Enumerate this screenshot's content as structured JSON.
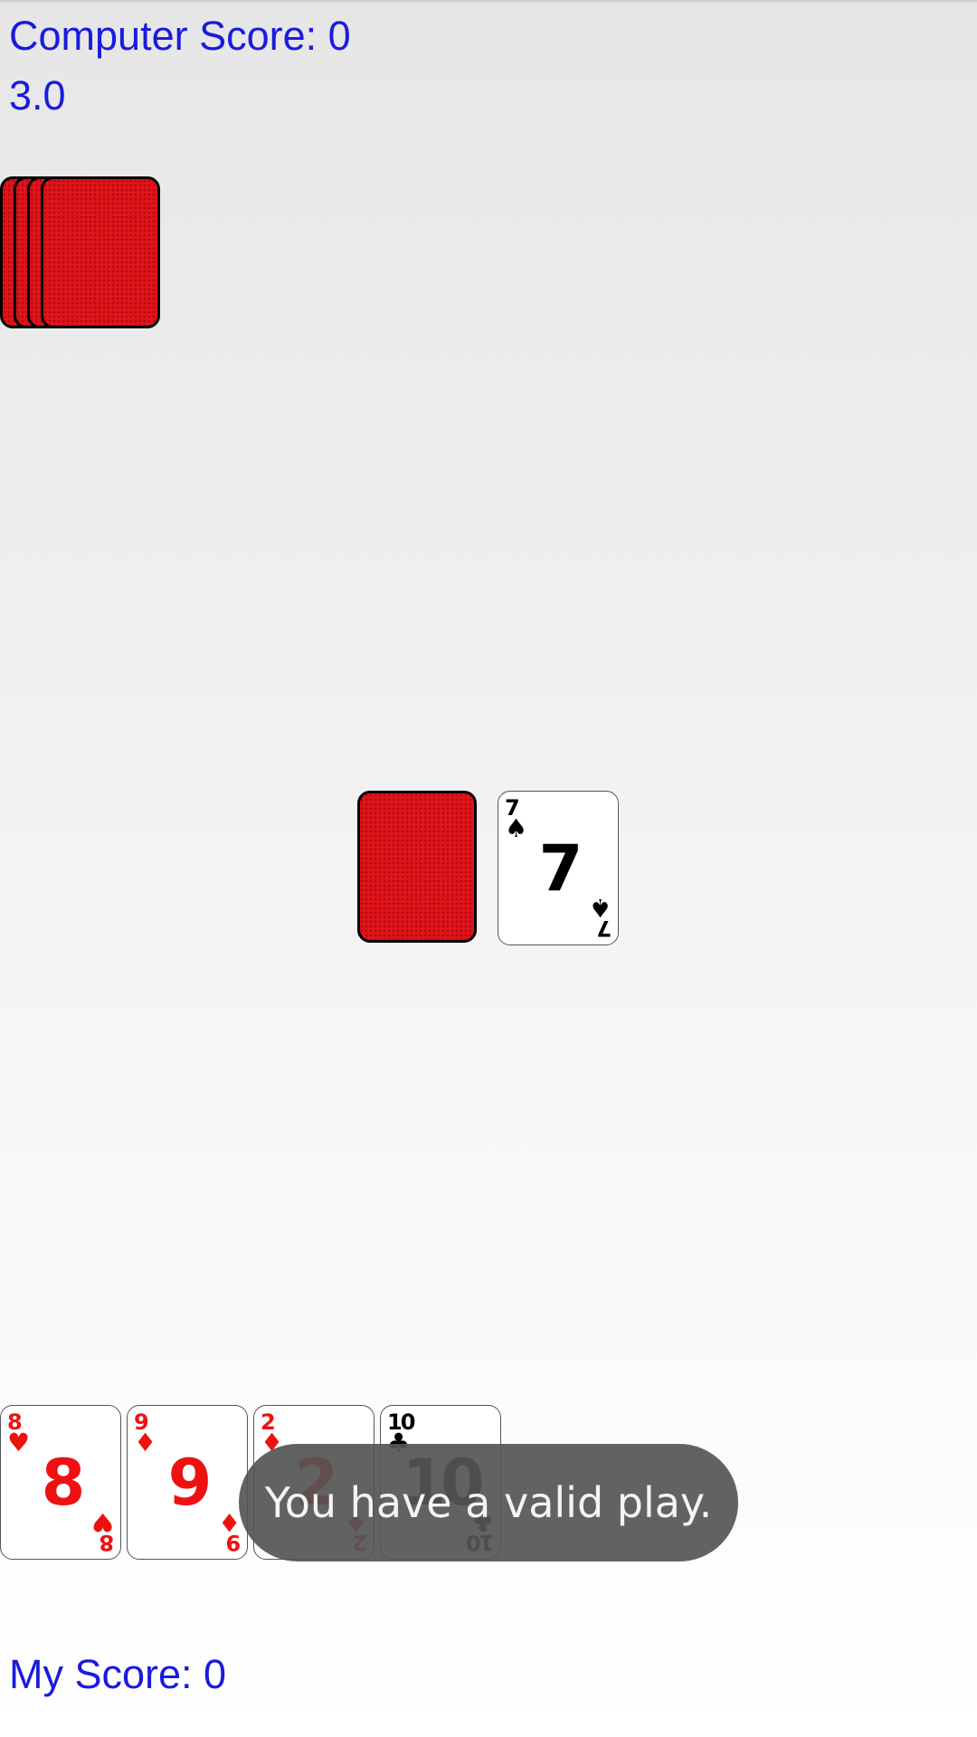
{
  "header": {
    "computer_score": "Computer Score: 0",
    "round_value": "3.0"
  },
  "computer_hand": {
    "card_count": 4
  },
  "table": {
    "draw_pile": "face-down",
    "discard_card": {
      "rank": "7",
      "suit": "♠",
      "color": "black"
    }
  },
  "player_hand": [
    {
      "rank": "8",
      "suit": "♥",
      "color": "red"
    },
    {
      "rank": "9",
      "suit": "♦",
      "color": "red"
    },
    {
      "rank": "2",
      "suit": "♦",
      "color": "red"
    },
    {
      "rank": "10",
      "suit": "♣",
      "color": "black"
    }
  ],
  "toast": {
    "message": "You have a valid play."
  },
  "footer": {
    "my_score": "My Score: 0"
  },
  "colors": {
    "score_text": "#1a1adf",
    "card_back": "#e0141b",
    "red_suit": "#ee1111",
    "black_suit": "#000000",
    "toast_bg": "#555555"
  }
}
